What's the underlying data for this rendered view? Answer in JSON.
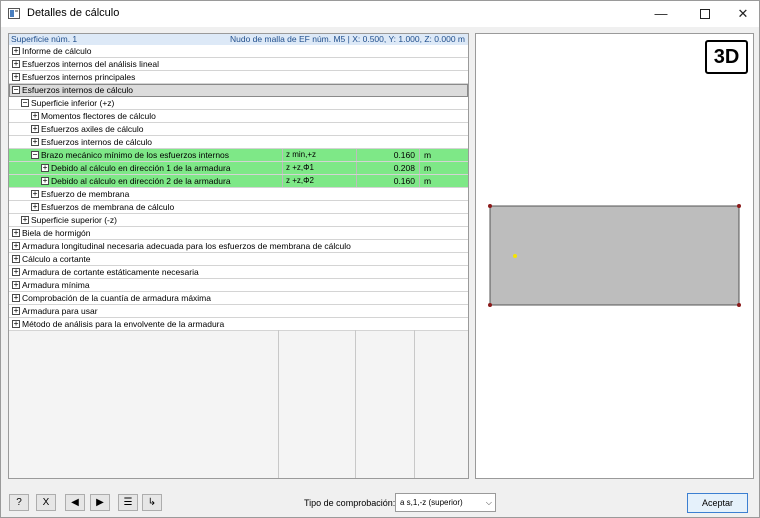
{
  "window": {
    "title": "Detalles de cálculo",
    "minimize": "—",
    "maximize": "☐",
    "close": "✕"
  },
  "header": {
    "left": "Superficie núm. 1",
    "right": "Nudo de malla de EF núm. M5  |  X: 0.500, Y: 1.000, Z: 0.000 m"
  },
  "rows": [
    {
      "label": "Informe de cálculo",
      "level": 0,
      "expander": "+"
    },
    {
      "label": "Esfuerzos internos del análisis lineal",
      "level": 0,
      "expander": "+"
    },
    {
      "label": "Esfuerzos internos principales",
      "level": 0,
      "expander": "+"
    },
    {
      "label": "Esfuerzos internos de cálculo",
      "level": 0,
      "expander": "−",
      "selected": true
    },
    {
      "label": "Superficie inferior (+z)",
      "level": 1,
      "expander": "−"
    },
    {
      "label": "Momentos flectores de cálculo",
      "level": 2,
      "expander": "+"
    },
    {
      "label": "Esfuerzos axiles de cálculo",
      "level": 2,
      "expander": "+"
    },
    {
      "label": "Esfuerzos internos de cálculo",
      "level": 2,
      "expander": "+"
    },
    {
      "label": "Brazo mecánico mínimo de los esfuerzos internos",
      "level": 2,
      "expander": "−",
      "green": true,
      "symbol": "z min,+z",
      "value": "0.160",
      "unit": "m"
    },
    {
      "label": "Debido al cálculo en dirección 1 de la armadura",
      "level": 3,
      "expander": "+",
      "green": true,
      "symbol": "z +z,Φ1",
      "value": "0.208",
      "unit": "m"
    },
    {
      "label": "Debido al cálculo en dirección 2 de la armadura",
      "level": 3,
      "expander": "+",
      "green": true,
      "symbol": "z +z,Φ2",
      "value": "0.160",
      "unit": "m"
    },
    {
      "label": "Esfuerzo de membrana",
      "level": 2,
      "expander": "+"
    },
    {
      "label": "Esfuerzos de membrana de cálculo",
      "level": 2,
      "expander": "+"
    },
    {
      "label": "Superficie superior (-z)",
      "level": 1,
      "expander": "+"
    },
    {
      "label": "Biela de hormigón",
      "level": 0,
      "expander": "+"
    },
    {
      "label": "Armadura longitudinal necesaria adecuada para los esfuerzos de membrana de cálculo",
      "level": 0,
      "expander": "+"
    },
    {
      "label": "Cálculo a cortante",
      "level": 0,
      "expander": "+"
    },
    {
      "label": "Armadura de cortante estáticamente necesaria",
      "level": 0,
      "expander": "+"
    },
    {
      "label": "Armadura mínima",
      "level": 0,
      "expander": "+"
    },
    {
      "label": "Comprobación de la cuantía de armadura máxima",
      "level": 0,
      "expander": "+"
    },
    {
      "label": "Armadura para usar",
      "level": 0,
      "expander": "+"
    },
    {
      "label": "Método de análisis para la envolvente de la armadura",
      "level": 0,
      "expander": "+"
    }
  ],
  "view": {
    "badge": "3D",
    "surface_color": "#bdbdbd",
    "node_color": "#8b1a1a",
    "point_color": "#f5e400"
  },
  "footer": {
    "tipo_label": "Tipo de comprobación:",
    "tipo_value": "a s,1,-z (superior)",
    "accept": "Aceptar",
    "tools": [
      {
        "name": "help-icon",
        "glyph": "?"
      },
      {
        "name": "excel-icon",
        "glyph": "X"
      },
      {
        "name": "previous-icon",
        "glyph": "◀"
      },
      {
        "name": "next-icon",
        "glyph": "▶"
      },
      {
        "name": "list-settings-icon",
        "glyph": "☰"
      },
      {
        "name": "coordinate-icon",
        "glyph": "↳"
      }
    ]
  }
}
